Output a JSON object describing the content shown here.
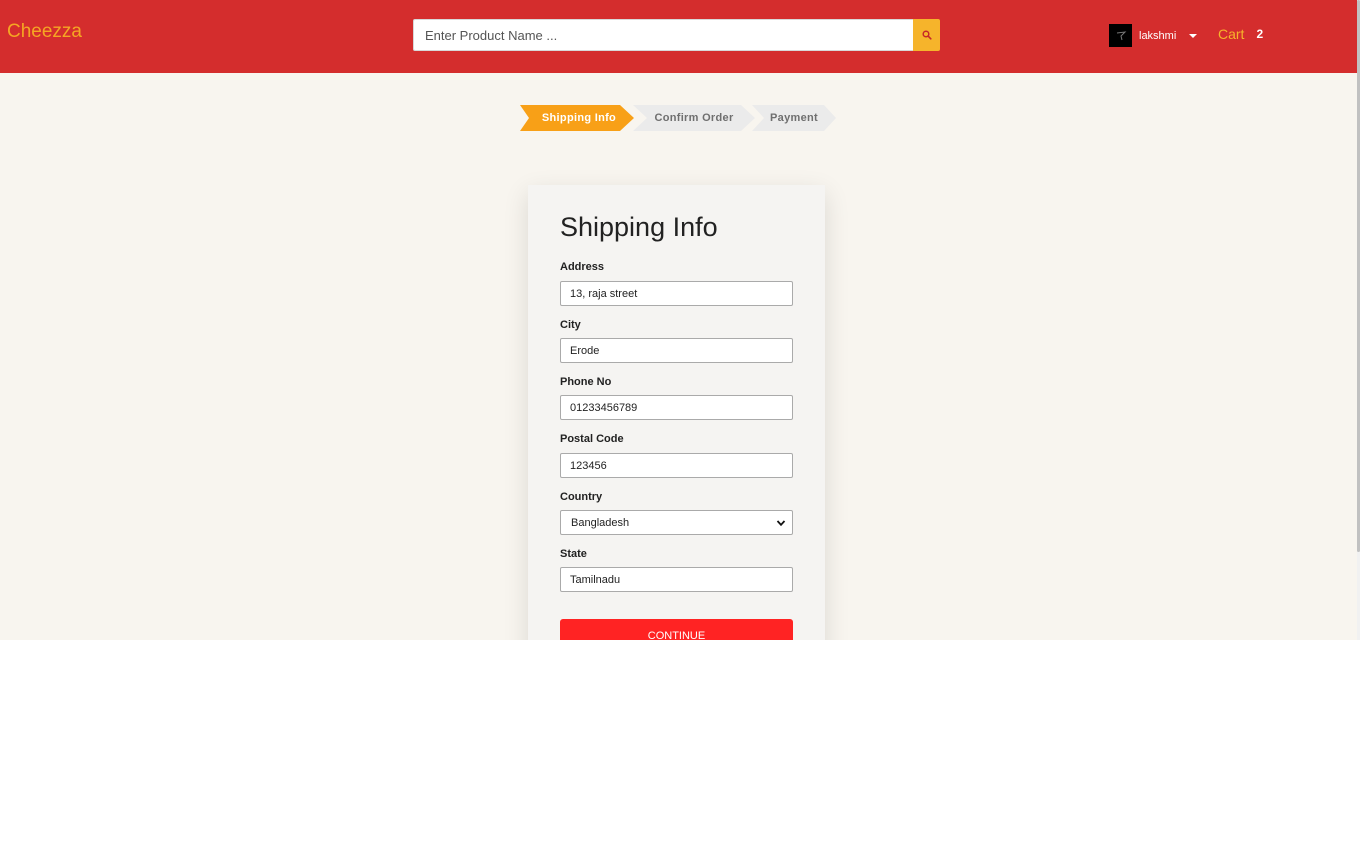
{
  "header": {
    "brand": "Cheezza",
    "search_placeholder": "Enter Product Name ...",
    "username": "lakshmi",
    "cart_label": "Cart",
    "cart_count": "2"
  },
  "steps": [
    "Shipping Info",
    "Confirm Order",
    "Payment"
  ],
  "form": {
    "title": "Shipping Info",
    "fields": [
      {
        "label": "Address",
        "value": "13, raja street"
      },
      {
        "label": "City",
        "value": "Erode"
      },
      {
        "label": "Phone No",
        "value": "01233456789"
      },
      {
        "label": "Postal Code",
        "value": "123456"
      },
      {
        "label": "Country",
        "value": "Bangladesh"
      },
      {
        "label": "State",
        "value": "Tamilnadu"
      }
    ],
    "submit_label": "CONTINUE"
  },
  "colors": {
    "navbar": "#d42d2d",
    "brand": "#f5a623",
    "accent": "#f8a017",
    "button": "#ff2323",
    "background": "#f8f5ef"
  }
}
